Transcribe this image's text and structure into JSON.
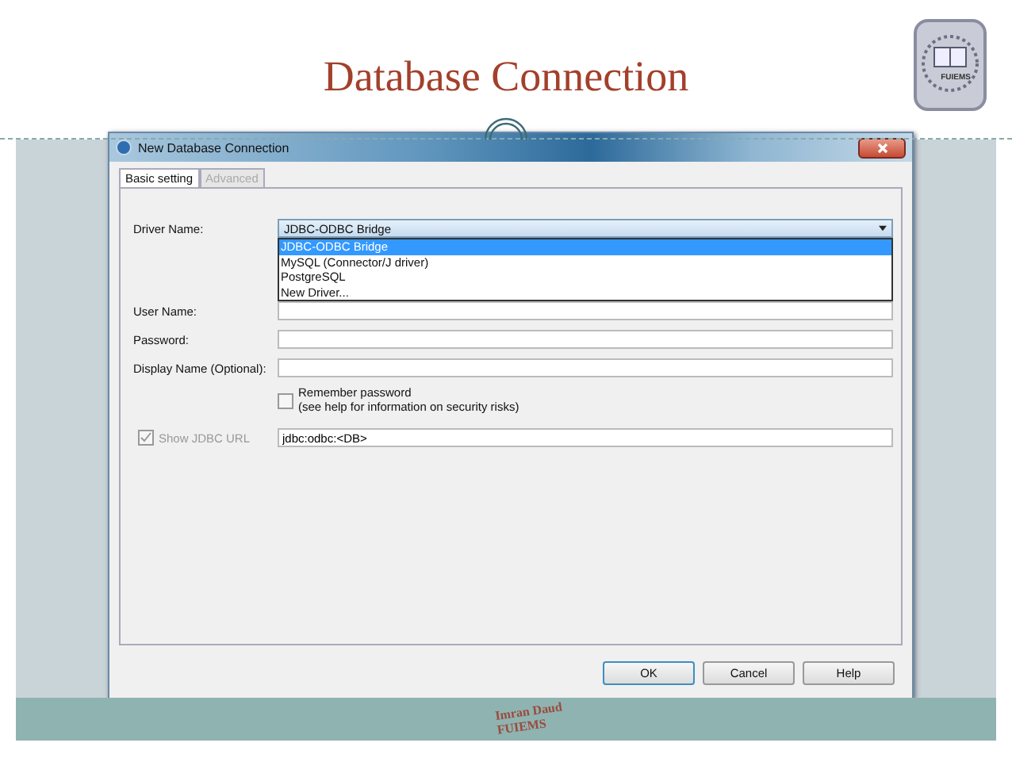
{
  "slide": {
    "title": "Database Connection",
    "logo_text": "FUIEMS",
    "footer": [
      "Imran Daud",
      "FUIEMS"
    ]
  },
  "dialog": {
    "title": "New Database Connection",
    "tabs": [
      {
        "label": "Basic setting",
        "selected": true,
        "disabled": false
      },
      {
        "label": "Advanced",
        "selected": false,
        "disabled": true
      }
    ],
    "driver": {
      "label": "Driver Name:",
      "value": "JDBC-ODBC Bridge",
      "expanded": true,
      "options": [
        {
          "label": "JDBC-ODBC Bridge",
          "selected": true
        },
        {
          "label": "MySQL (Connector/J driver)",
          "selected": false
        },
        {
          "label": "PostgreSQL",
          "selected": false
        },
        {
          "label": "New Driver...",
          "selected": false
        }
      ]
    },
    "fields": [
      {
        "label": "User Name:"
      },
      {
        "label": "Password:"
      },
      {
        "label": "Display Name (Optional):"
      }
    ],
    "remember": {
      "lines": [
        "Remember password",
        "(see help for information on security risks)"
      ],
      "checked": false
    },
    "show_url": {
      "label": "Show JDBC URL",
      "checked": true,
      "disabled": true,
      "value": "jdbc:odbc:<DB>"
    },
    "buttons": [
      {
        "label": "OK",
        "default": true
      },
      {
        "label": "Cancel",
        "default": false
      },
      {
        "label": "Help",
        "default": false
      }
    ]
  }
}
